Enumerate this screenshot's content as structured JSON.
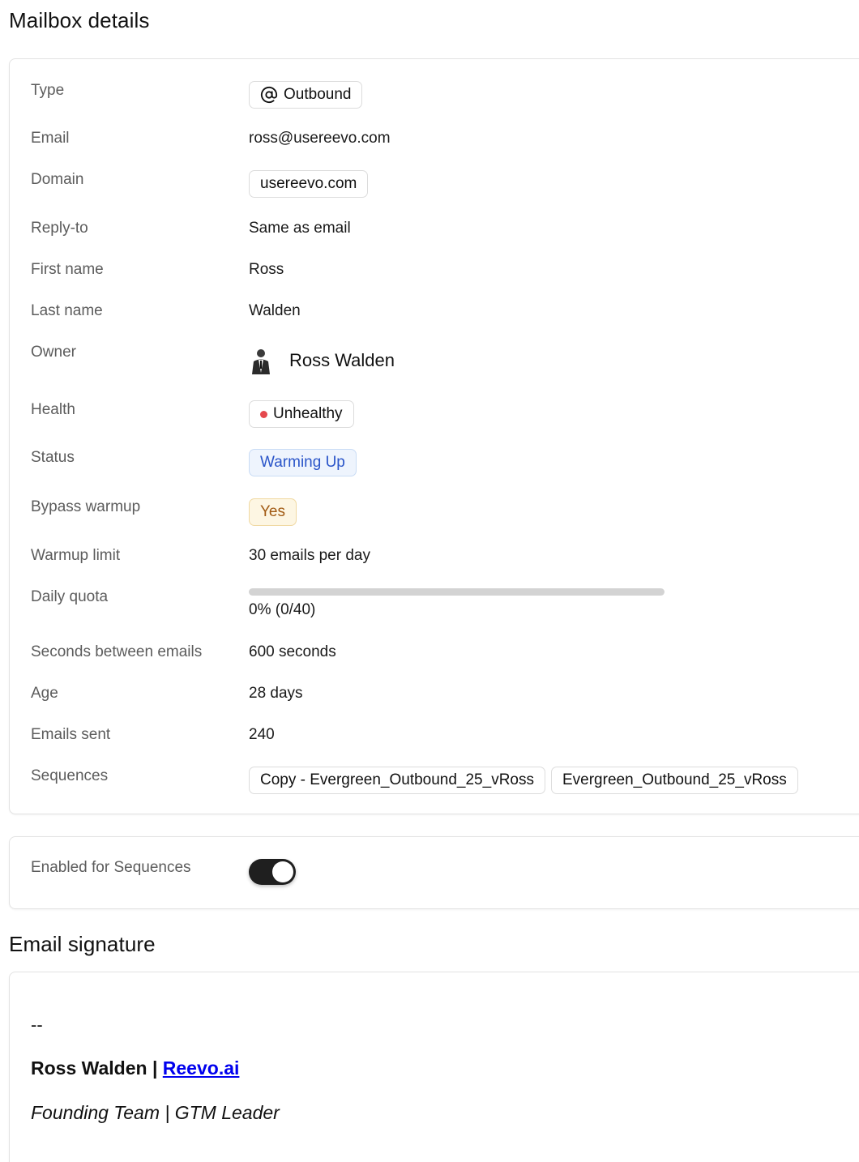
{
  "details": {
    "title": "Mailbox details",
    "type": {
      "label": "Type",
      "value": "Outbound",
      "icon": "at-sign-icon"
    },
    "email": {
      "label": "Email",
      "value": "ross@usereevo.com"
    },
    "domain": {
      "label": "Domain",
      "value": "usereevo.com"
    },
    "reply_to": {
      "label": "Reply-to",
      "value": "Same as email"
    },
    "first_name": {
      "label": "First name",
      "value": "Ross"
    },
    "last_name": {
      "label": "Last name",
      "value": "Walden"
    },
    "owner": {
      "label": "Owner",
      "value": "Ross Walden"
    },
    "health": {
      "label": "Health",
      "value": "Unhealthy",
      "dot_color": "#e5484d"
    },
    "status": {
      "label": "Status",
      "value": "Warming Up"
    },
    "bypass_warmup": {
      "label": "Bypass warmup",
      "value": "Yes"
    },
    "warmup_limit": {
      "label": "Warmup limit",
      "value": "30 emails per day"
    },
    "daily_quota": {
      "label": "Daily quota",
      "value": "0% (0/40)",
      "fraction": 0
    },
    "seconds_between": {
      "label": "Seconds between emails",
      "value": "600 seconds"
    },
    "age": {
      "label": "Age",
      "value": "28 days"
    },
    "emails_sent": {
      "label": "Emails sent",
      "value": "240"
    },
    "sequences": {
      "label": "Sequences",
      "items": [
        "Copy - Evergreen_Outbound_25_vRoss",
        "Evergreen_Outbound_25_vRoss"
      ]
    }
  },
  "enabled": {
    "label": "Enabled for Sequences",
    "on": true
  },
  "signature": {
    "title": "Email signature",
    "dash": "--",
    "name": "Ross Walden | ",
    "link": "Reevo.ai",
    "role": "Founding Team | GTM Leader"
  },
  "colors": {
    "accent_blue": "#2a55c9",
    "toggle": "#1f1f1f",
    "warning": "#a15a13"
  }
}
